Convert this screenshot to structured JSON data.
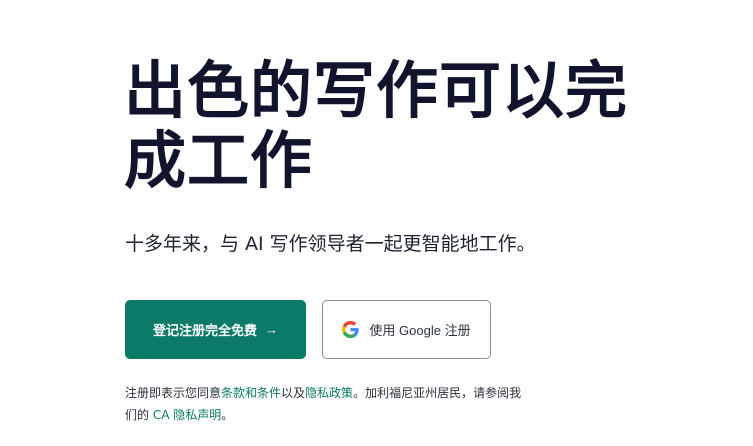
{
  "hero": {
    "title": "出色的写作可以完成工作",
    "subtitle": "十多年来，与 AI 写作领导者一起更智能地工作。"
  },
  "cta": {
    "signup_label": "登记注册完全免费",
    "signup_arrow": "→",
    "google_label": "使用 Google 注册",
    "google_icon": "google-g-icon"
  },
  "legal": {
    "prefix": "注册即表示您同意",
    "terms_link": "条款和条件",
    "and": "以及",
    "privacy_link": "隐私政策",
    "ca_prefix": "。加利福尼亚州居民，请参阅我们的 ",
    "ca_link": "CA 隐私声明",
    "suffix": "。"
  },
  "colors": {
    "accent": "#0b7a66",
    "heading": "#11142d",
    "border": "#8a8f99"
  }
}
